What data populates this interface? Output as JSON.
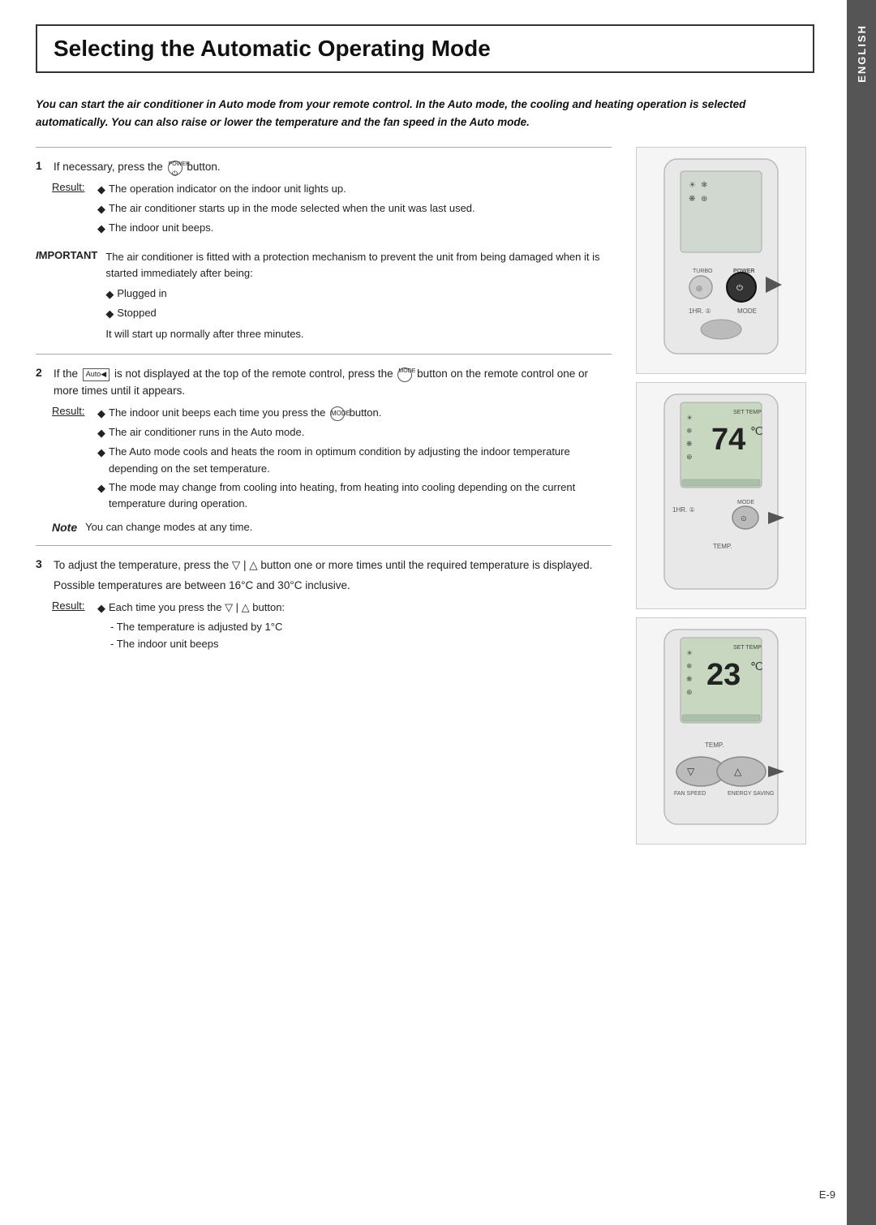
{
  "page": {
    "title": "Selecting the Automatic Operating Mode",
    "sidebar_label": "ENGLISH",
    "page_number": "E-9"
  },
  "intro": {
    "text": "You can start the air conditioner in Auto mode from your remote control. In the Auto mode, the cooling and heating operation is selected automatically. You can also raise or lower the temperature and the fan speed in the Auto mode."
  },
  "steps": [
    {
      "num": "1",
      "text": "If necessary, press the  button.",
      "result_label": "Result:",
      "result_items": [
        "The operation indicator on the indoor unit lights up.",
        "The air conditioner starts up in the mode selected when the unit was last used.",
        "The indoor unit beeps."
      ]
    },
    {
      "num": "2",
      "text": "If the  is not displayed at the top of the remote control, press the  button on the remote control one or more times until it appears.",
      "result_label": "Result:",
      "result_items": [
        "The indoor unit beeps each time you press the  button.",
        "The air conditioner runs in the Auto mode.",
        "The Auto mode cools and heats the room in optimum condition by adjusting the indoor temperature depending on the set temperature.",
        "The mode may change from cooling into heating, from heating into cooling depending on the current temperature during operation."
      ]
    },
    {
      "num": "3",
      "text": "To adjust the temperature, press the ▽ | △ button one or more times until the required temperature is displayed.",
      "extra_text": "Possible temperatures are between 16°C and 30°C inclusive.",
      "result_label": "Result:",
      "result_items": [
        "Each time you press the ▽ | △ button:"
      ],
      "sub_items": [
        "- The temperature is adjusted by 1°C",
        "- The indoor unit beeps"
      ]
    }
  ],
  "important": {
    "label": "IMPORTANT",
    "text": "The air conditioner is fitted with a protection mechanism to prevent the unit from being damaged when it is started immediately after being:",
    "bullets": [
      "Plugged in",
      "Stopped"
    ],
    "footer": "It will start up normally after three minutes."
  },
  "note": {
    "label": "Note",
    "text": "You can change modes at any time."
  },
  "buttons": {
    "power": "POWER",
    "mode": "MODE",
    "temp_up": "△",
    "temp_down": "▽"
  }
}
